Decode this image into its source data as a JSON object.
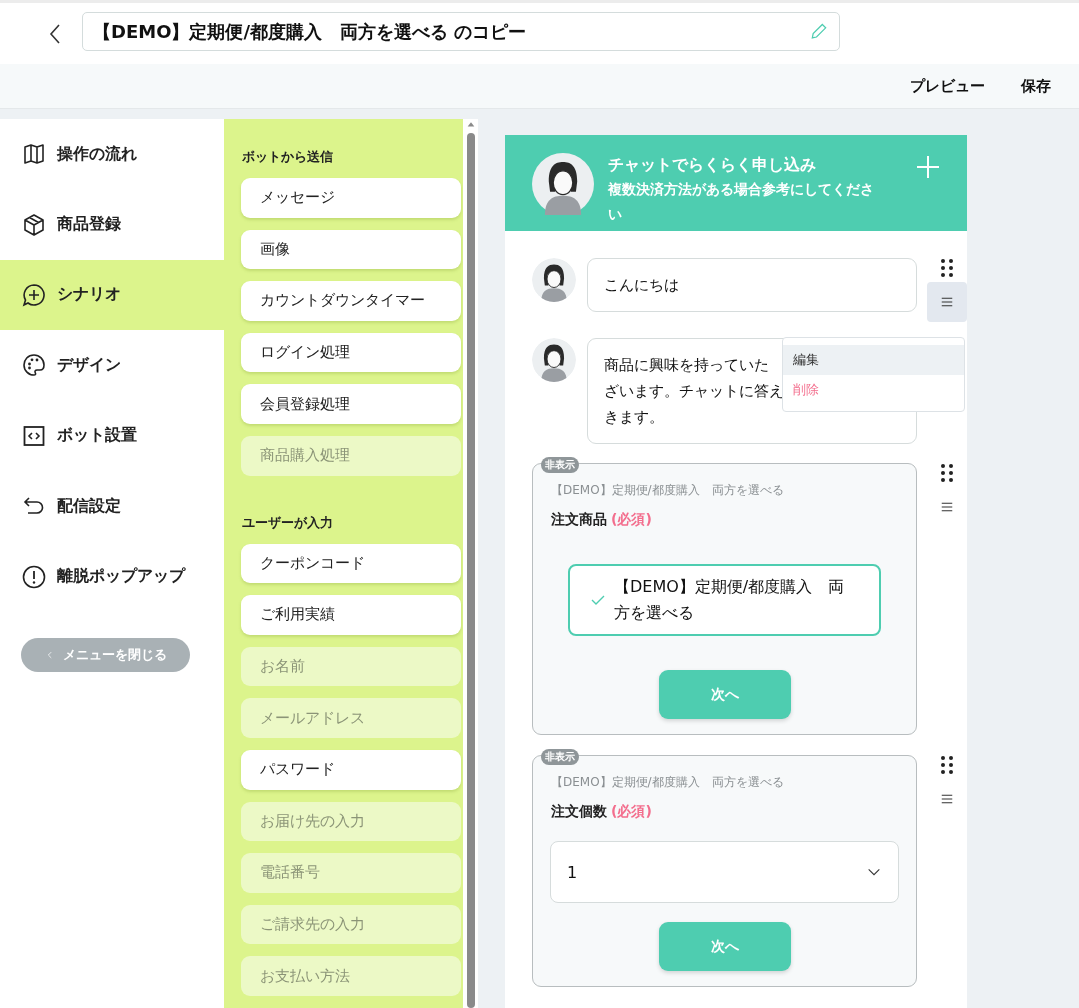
{
  "header": {
    "title": "【DEMO】定期便/都度購入　両方を選べる のコピー"
  },
  "toolbar": {
    "buttons": [
      "プレビュー",
      "保存"
    ]
  },
  "nav": {
    "items": [
      {
        "label": "操作の流れ",
        "selected": false
      },
      {
        "label": "商品登録",
        "selected": false
      },
      {
        "label": "シナリオ",
        "selected": true
      },
      {
        "label": "デザイン",
        "selected": false
      },
      {
        "label": "ボット設置",
        "selected": false
      },
      {
        "label": "配信設定",
        "selected": false
      },
      {
        "label": "離脱ポップアップ",
        "selected": false
      }
    ],
    "close_button": "メニューを閉じる"
  },
  "palette": {
    "sections": [
      {
        "heading": "ボットから送信",
        "items": [
          {
            "label": "メッセージ",
            "disabled": false
          },
          {
            "label": "画像",
            "disabled": false
          },
          {
            "label": "カウントダウンタイマー",
            "disabled": false
          },
          {
            "label": "ログイン処理",
            "disabled": false
          },
          {
            "label": "会員登録処理",
            "disabled": false
          },
          {
            "label": "商品購入処理",
            "disabled": true
          }
        ]
      },
      {
        "heading": "ユーザーが入力",
        "items": [
          {
            "label": "クーポンコード",
            "disabled": false
          },
          {
            "label": "ご利用実績",
            "disabled": false
          },
          {
            "label": "お名前",
            "disabled": true
          },
          {
            "label": "メールアドレス",
            "disabled": true
          },
          {
            "label": "パスワード",
            "disabled": false
          },
          {
            "label": "お届け先の入力",
            "disabled": true
          },
          {
            "label": "電話番号",
            "disabled": true
          },
          {
            "label": "ご請求先の入力",
            "disabled": true
          },
          {
            "label": "お支払い方法",
            "disabled": true
          }
        ]
      }
    ]
  },
  "chat": {
    "header": {
      "title": "チャットでらくらく申し込み",
      "subtitle": "複数決済方法がある場合参考にしてください"
    },
    "messages": [
      {
        "kind": "text",
        "lines": [
          "こんにちは"
        ],
        "menu_open": true
      },
      {
        "kind": "text",
        "lines": [
          "商品に興味を持っていた",
          "ざいます。チャットに答え",
          "きます。"
        ],
        "menu_open": false
      },
      {
        "kind": "choice",
        "badge": "非表示",
        "caption": "【DEMO】定期便/都度購入　両方を選べる",
        "label": "注文商品",
        "required": "(必須)",
        "option": {
          "label": "【DEMO】定期便/都度購入　両方を選べる",
          "checked": true
        },
        "button": "次へ",
        "menu_open": false
      },
      {
        "kind": "select",
        "badge": "非表示",
        "caption": "【DEMO】定期便/都度購入　両方を選べる",
        "label": "注文個数",
        "required": "(必須)",
        "value": "1",
        "button": "次へ",
        "menu_open": false
      }
    ],
    "menu": {
      "items": [
        {
          "label": "編集",
          "kind": "normal",
          "selected": true
        },
        {
          "label": "削除",
          "kind": "danger",
          "selected": false
        }
      ]
    }
  }
}
